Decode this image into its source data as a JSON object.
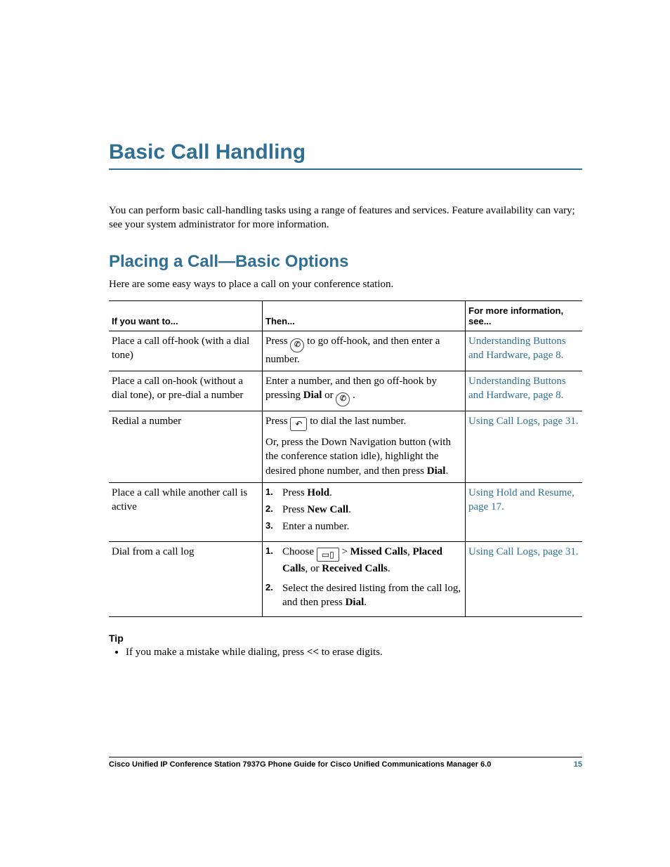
{
  "chapter_title": "Basic Call Handling",
  "intro": "You can perform basic call-handling tasks using a range of features and services. Feature availability can vary; see your system administrator for more information.",
  "section_title": "Placing a Call—Basic Options",
  "section_lead": "Here are some easy ways to place a call on your conference station.",
  "table": {
    "headers": {
      "col1": "If you want to...",
      "col2": "Then...",
      "col3": "For more information, see..."
    },
    "rows": [
      {
        "want": "Place a call off-hook (with a dial tone)",
        "then_pre": "Press ",
        "then_post": " to go off-hook, and then enter a number.",
        "see": "Understanding Buttons and Hardware, page 8."
      },
      {
        "want": "Place a call on-hook (without a dial tone), or pre-dial a number",
        "then_a": "Enter a number, and then go off-hook by pressing ",
        "then_b": "Dial",
        "then_c": " or ",
        "then_d": " .",
        "see": "Understanding Buttons and Hardware, page 8."
      },
      {
        "want": "Redial a number",
        "then_pre": "Press ",
        "then_post": " to dial the last number.",
        "then_sub": "Or, press the Down Navigation button (with the conference station idle), highlight the desired phone number, and then press ",
        "then_sub_b": "Dial",
        "then_sub_c": ".",
        "see": "Using Call Logs, page 31."
      },
      {
        "want": "Place a call while another call is active",
        "steps": [
          {
            "num": "1.",
            "pre": "Press ",
            "b": "Hold",
            "post": "."
          },
          {
            "num": "2.",
            "pre": "Press ",
            "b": "New Call",
            "post": "."
          },
          {
            "num": "3.",
            "pre": "Enter a number.",
            "b": "",
            "post": ""
          }
        ],
        "see": "Using Hold and Resume, page 17."
      },
      {
        "want": "Dial from a call log",
        "steps": [
          {
            "num": "1.",
            "pre": "Choose ",
            "icon": true,
            "mid": " > ",
            "b1": "Missed Calls",
            "mid2": ", ",
            "b2": "Placed Calls",
            "mid3": ", or ",
            "b3": "Received Calls",
            "post": "."
          },
          {
            "num": "2.",
            "pre": "Select the desired listing from the call log, and then press ",
            "b": "Dial",
            "post": "."
          }
        ],
        "see": "Using Call Logs, page 31."
      }
    ]
  },
  "tip_label": "Tip",
  "tip_items": [
    {
      "pre": "If you make a mistake while dialing, press ",
      "b": "<<",
      "post": " to erase digits."
    }
  ],
  "footer": {
    "title": "Cisco Unified IP Conference Station 7937G Phone Guide for Cisco Unified Communications Manager 6.0",
    "page": "15"
  }
}
